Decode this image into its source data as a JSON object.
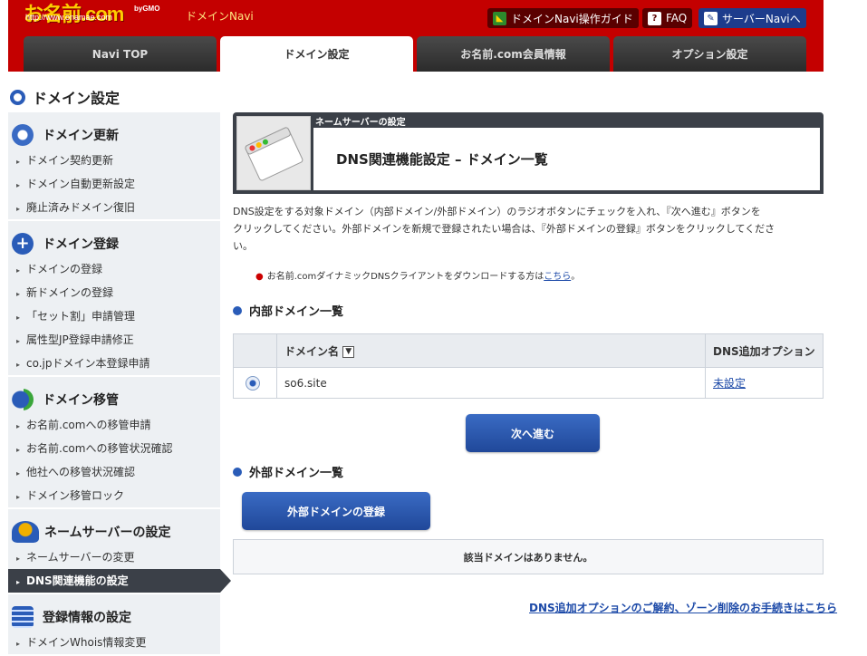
{
  "header": {
    "logo": "お名前.com",
    "logo_url": "http://www.onamae.com",
    "logo_gmo": "byGMO",
    "navi_title": "ドメインNavi",
    "buttons": [
      "ドメインNavi操作ガイド",
      "FAQ",
      "サーバーNaviへ"
    ]
  },
  "tabs": [
    "Navi TOP",
    "ドメイン設定",
    "お名前.com会員情報",
    "オプション設定"
  ],
  "page_title": "ドメイン設定",
  "sidebar": {
    "groups": [
      {
        "title": "ドメイン更新",
        "items": [
          "ドメイン契約更新",
          "ドメイン自動更新設定",
          "廃止済みドメイン復旧"
        ]
      },
      {
        "title": "ドメイン登録",
        "items": [
          "ドメインの登録",
          "新ドメインの登録",
          "「セット割」申請管理",
          "属性型JP登録申請修正",
          "co.jpドメイン本登録申請"
        ]
      },
      {
        "title": "ドメイン移管",
        "items": [
          "お名前.comへの移管申請",
          "お名前.comへの移管状況確認",
          "他社への移管状況確認",
          "ドメイン移管ロック"
        ]
      },
      {
        "title": "ネームサーバーの設定",
        "items": [
          "ネームサーバーの変更",
          "DNS関連機能の設定"
        ]
      },
      {
        "title": "登録情報の設定",
        "items": [
          "ドメインWhois情報変更"
        ]
      }
    ]
  },
  "main": {
    "subheading": "ネームサーバーの設定",
    "title": "DNS関連機能設定 – ドメイン一覧",
    "description_lines": [
      "DNS設定をする対象ドメイン（内部ドメイン/外部ドメイン）のラジオボタンにチェックを入れ、『次へ進む』ボタンを",
      "クリックしてください。外部ドメインを新規で登録されたい場合は、『外部ドメインの登録』ボタンをクリックしてくださ",
      "い。"
    ],
    "note": "お名前.comダイナミックDNSクライアントをダウンロードする方は",
    "note_link": "こちら",
    "note_end": "。",
    "internal_title": "内部ドメイン一覧",
    "table_headers": [
      "ドメイン名",
      "DNS追加オプション"
    ],
    "rows": [
      {
        "domain": "so6.site",
        "option": "未設定"
      }
    ],
    "next_button": "次へ進む",
    "external_title": "外部ドメイン一覧",
    "external_button": "外部ドメインの登録",
    "empty_message": "該当ドメインはありません。",
    "bottom_link": "DNS追加オプションのご解約、ゾーン削除のお手続きはこちら"
  }
}
